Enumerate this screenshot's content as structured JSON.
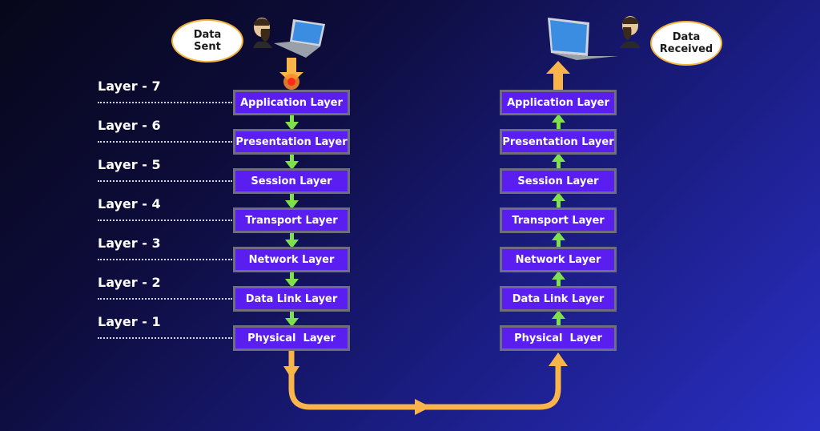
{
  "diagram": {
    "sender_bubble": {
      "line1": "Data",
      "line2": "Sent"
    },
    "receiver_bubble": {
      "line1": "Data",
      "line2": "Received"
    },
    "layer_labels": [
      "Layer - 7",
      "Layer - 6",
      "Layer - 5",
      "Layer - 4",
      "Layer - 3",
      "Layer - 2",
      "Layer - 1"
    ],
    "sender_stack": [
      "Application Layer",
      "Presentation Layer",
      "Session Layer",
      "Transport Layer",
      "Network Layer",
      "Data Link Layer",
      "Physical  Layer"
    ],
    "receiver_stack": [
      "Application Layer",
      "Presentation Layer",
      "Session Layer",
      "Transport Layer",
      "Network Layer",
      "Data Link Layer",
      "Physical  Layer"
    ],
    "colors": {
      "box_fill": "#5a1ef0",
      "box_border": "#6e6e7e",
      "flow_arrow": "#f9b44a",
      "layer_arrow": "#7ee04a",
      "start_dot": "#ff3b1f"
    }
  }
}
